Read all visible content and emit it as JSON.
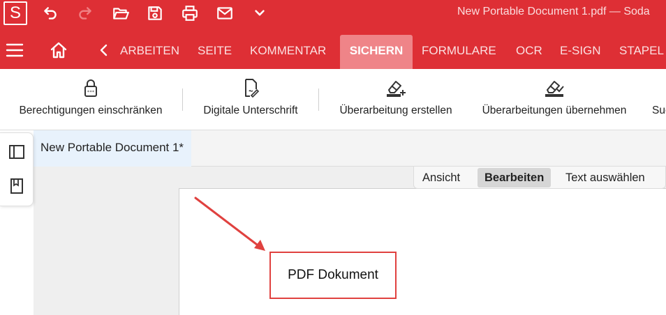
{
  "app": {
    "logo_letter": "S",
    "window_title": "New Portable Document 1.pdf   —   Soda",
    "colors": {
      "accent": "#de2f35",
      "active_tab": "#ef8488",
      "annotation": "#e0413f"
    }
  },
  "quick_access": [
    "undo-icon",
    "redo-icon",
    "open-folder-icon",
    "save-icon",
    "print-icon",
    "mail-icon",
    "chevron-down-icon"
  ],
  "tabs": [
    {
      "label": "ARBEITEN",
      "active": false
    },
    {
      "label": "SEITE",
      "active": false
    },
    {
      "label": "KOMMENTAR",
      "active": false
    },
    {
      "label": "SICHERN",
      "active": true
    },
    {
      "label": "FORMULARE",
      "active": false
    },
    {
      "label": "OCR",
      "active": false
    },
    {
      "label": "E-SIGN",
      "active": false
    },
    {
      "label": "STAPEL",
      "active": false
    }
  ],
  "ribbon": [
    {
      "label": "Berechtigungen einschränken",
      "icon": "lock-icon"
    },
    {
      "label": "Digitale Unterschrift",
      "icon": "signature-icon"
    },
    {
      "label": "Überarbeitung erstellen",
      "icon": "redact-add-icon"
    },
    {
      "label": "Überarbeitungen übernehmen",
      "icon": "redact-apply-icon"
    },
    {
      "label": "Suc",
      "icon": ""
    }
  ],
  "side_panel": [
    "sidebar-toggle-icon",
    "bookmark-icon"
  ],
  "document_tab": {
    "label": "New Portable Document 1*"
  },
  "modes": [
    {
      "label": "Ansicht",
      "active": false
    },
    {
      "label": "Bearbeiten",
      "active": true
    },
    {
      "label": "Text auswählen",
      "active": false
    }
  ],
  "page": {
    "text_box": "PDF Dokument"
  }
}
